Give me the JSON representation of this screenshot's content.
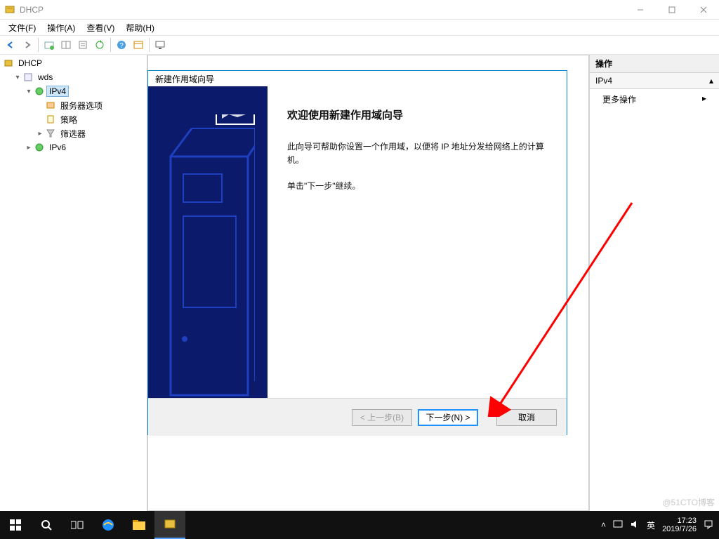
{
  "window": {
    "title": "DHCP"
  },
  "menu": {
    "file": "文件(F)",
    "action": "操作(A)",
    "view": "查看(V)",
    "help": "帮助(H)"
  },
  "tree": {
    "root": "DHCP",
    "server": "wds",
    "ipv4": "IPv4",
    "server_options": "服务器选项",
    "policies": "策略",
    "filters": "筛选器",
    "ipv6": "IPv6"
  },
  "actions": {
    "header": "操作",
    "selected": "IPv4",
    "more": "更多操作"
  },
  "wizard": {
    "title": "新建作用域向导",
    "heading": "欢迎使用新建作用域向导",
    "desc": "此向导可帮助你设置一个作用域，以便将 IP 地址分发给网络上的计算机。",
    "cont": "单击\"下一步\"继续。",
    "back": "< 上一步(B)",
    "next": "下一步(N) >",
    "cancel": "取消"
  },
  "taskbar": {
    "ime": "英",
    "time": "17:23",
    "date": "2019/7/26"
  },
  "watermark": "@51CTO博客"
}
